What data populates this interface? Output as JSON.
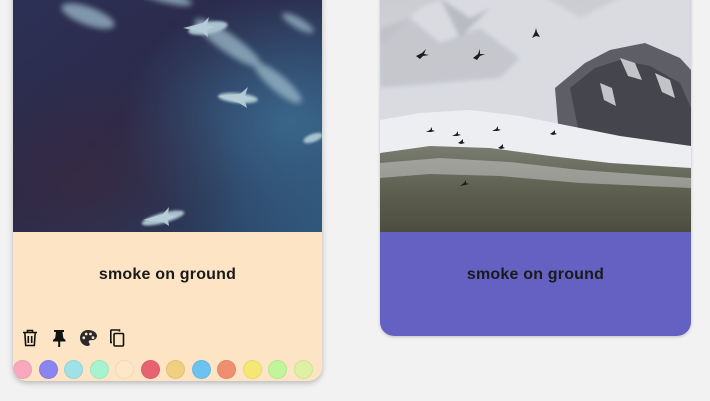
{
  "cards": [
    {
      "title": "smoke on ground",
      "background": "#fce4c5",
      "image": "fish-underwater-photo",
      "toolbar": {
        "icons": [
          "trash-icon",
          "pin-icon",
          "palette-icon",
          "copy-icon"
        ]
      },
      "palette": [
        "#f9a8c0",
        "#8b85ef",
        "#9fe1e6",
        "#a8f3cf",
        "#fde7c7",
        "#e56470",
        "#f0cf7e",
        "#6cc3f0",
        "#ef8f70",
        "#f6e774",
        "#c1f59a",
        "#dff0a3"
      ]
    },
    {
      "title": "smoke on ground",
      "background": "#6461c2",
      "image": "snowy-mountain-birds-photo"
    }
  ]
}
